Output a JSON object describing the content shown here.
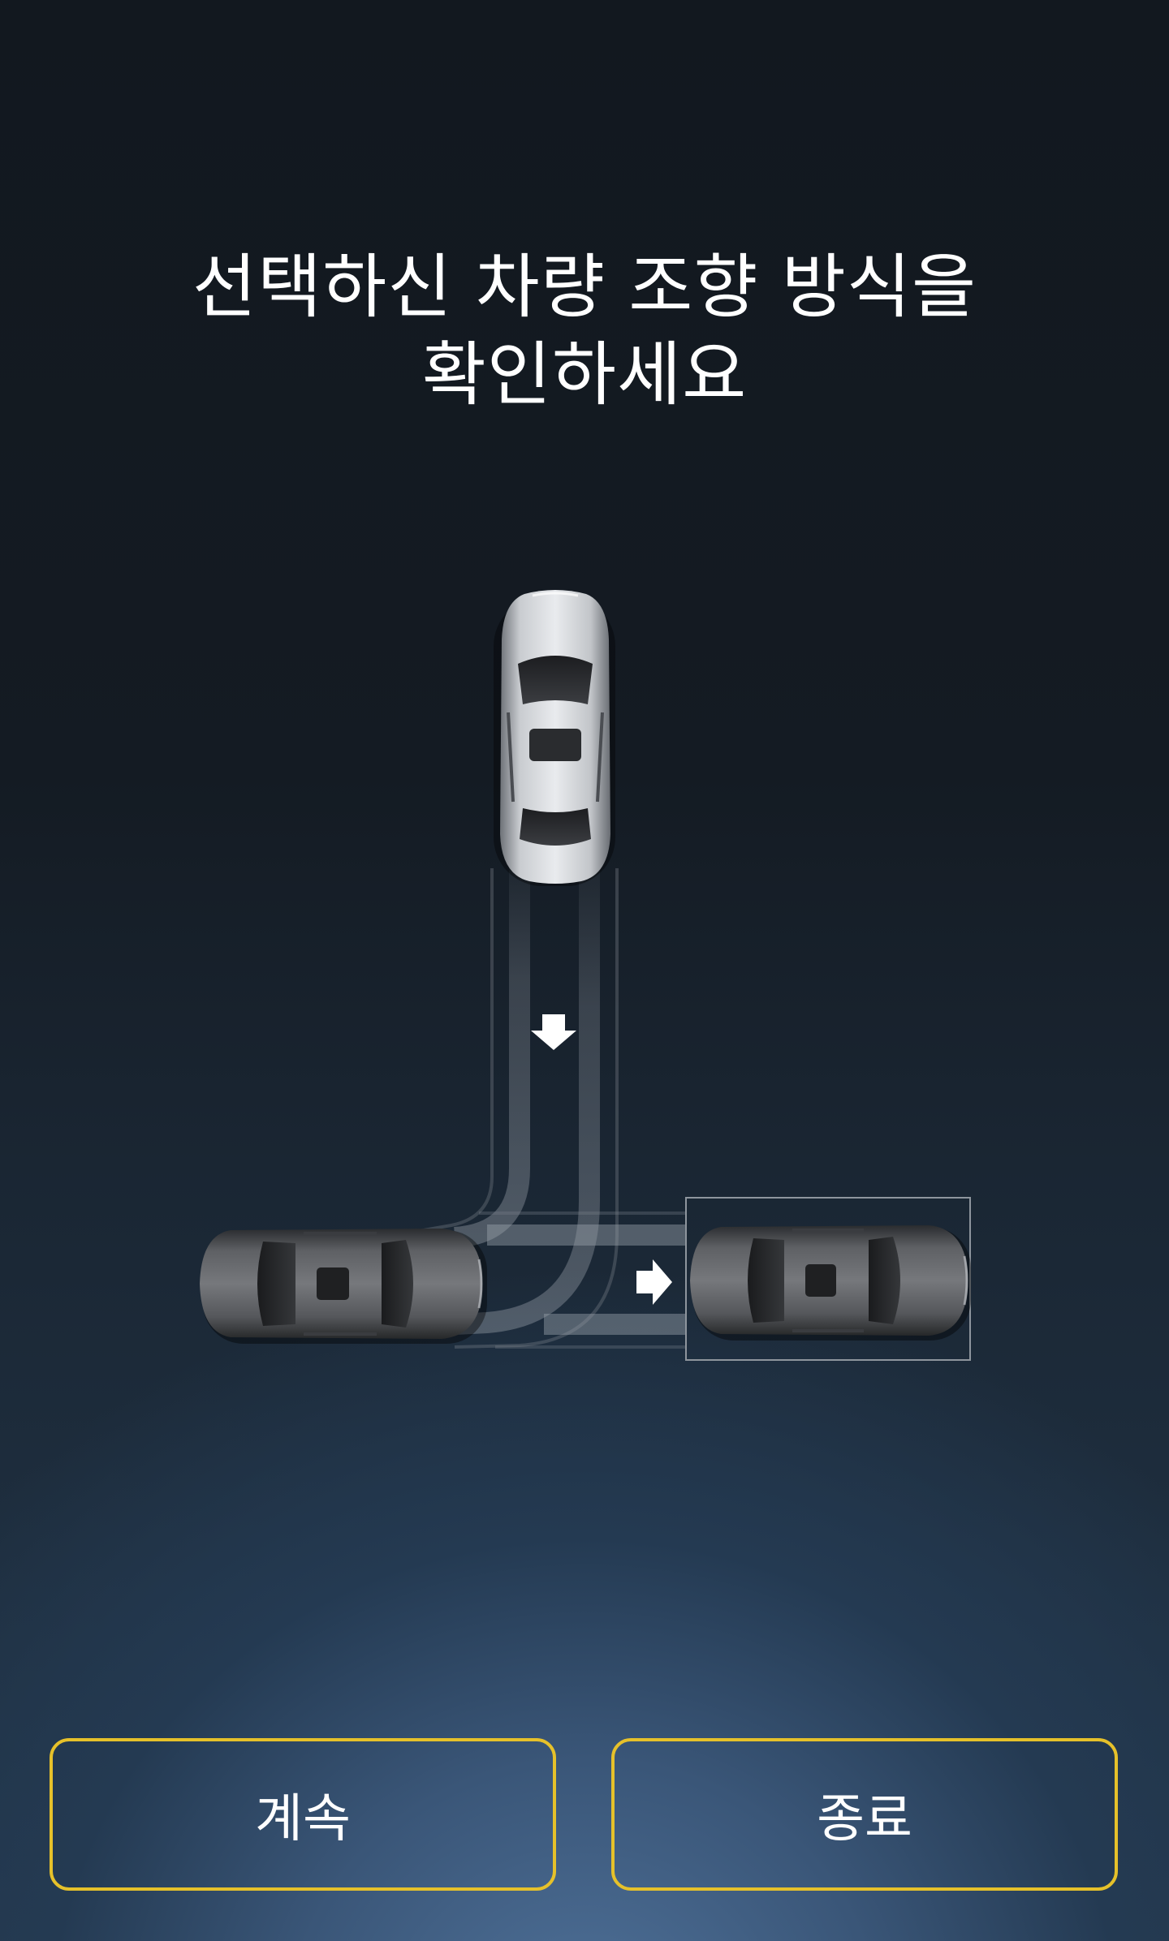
{
  "screen": {
    "title_line1": "선택하신 차량 조향 방식을",
    "title_line2": "확인하세요"
  },
  "illustration": {
    "icons": [
      "car-top-view",
      "arrow-down-icon",
      "arrow-right-icon",
      "parking-target-box"
    ]
  },
  "buttons": {
    "continue_label": "계속",
    "exit_label": "종료"
  },
  "colors": {
    "button_border": "#e6c12a",
    "text": "#ffffff",
    "background_top": "#12181f",
    "background_bottom_glow": "#4f7199"
  }
}
